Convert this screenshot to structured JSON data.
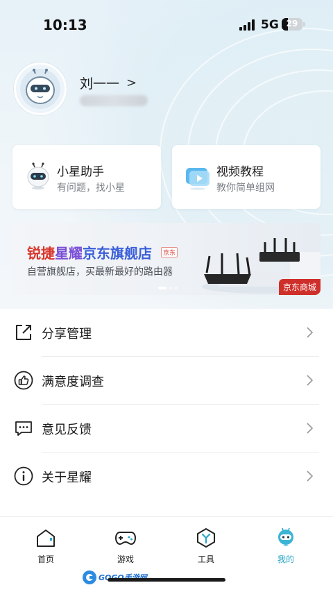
{
  "status_bar": {
    "time": "10:13",
    "network": "5G",
    "battery": "29"
  },
  "profile": {
    "name": "刘一一"
  },
  "quick_cards": [
    {
      "title": "小星助手",
      "subtitle": "有问题，找小星"
    },
    {
      "title": "视频教程",
      "subtitle": "教你简单组网"
    }
  ],
  "banner": {
    "title_part1": "锐捷",
    "title_part2": "星耀",
    "title_part3": "京东旗舰店",
    "logo_text": "京东",
    "subtitle": "自营旗舰店，买最新最好的路由器",
    "tag": "京东商城"
  },
  "menu": [
    {
      "label": "分享管理",
      "icon": "share-icon"
    },
    {
      "label": "满意度调查",
      "icon": "thumbs-up-icon"
    },
    {
      "label": "意见反馈",
      "icon": "feedback-icon"
    },
    {
      "label": "关于星耀",
      "icon": "info-icon"
    }
  ],
  "tabbar": [
    {
      "label": "首页",
      "icon": "home-icon"
    },
    {
      "label": "游戏",
      "icon": "gamepad-icon"
    },
    {
      "label": "工具",
      "icon": "tools-icon"
    },
    {
      "label": "我的",
      "icon": "mascot-icon",
      "active": true
    }
  ],
  "colors": {
    "accent": "#2aa5c8",
    "banner_red": "#d9362b",
    "tag_red": "#cf2f2a"
  }
}
